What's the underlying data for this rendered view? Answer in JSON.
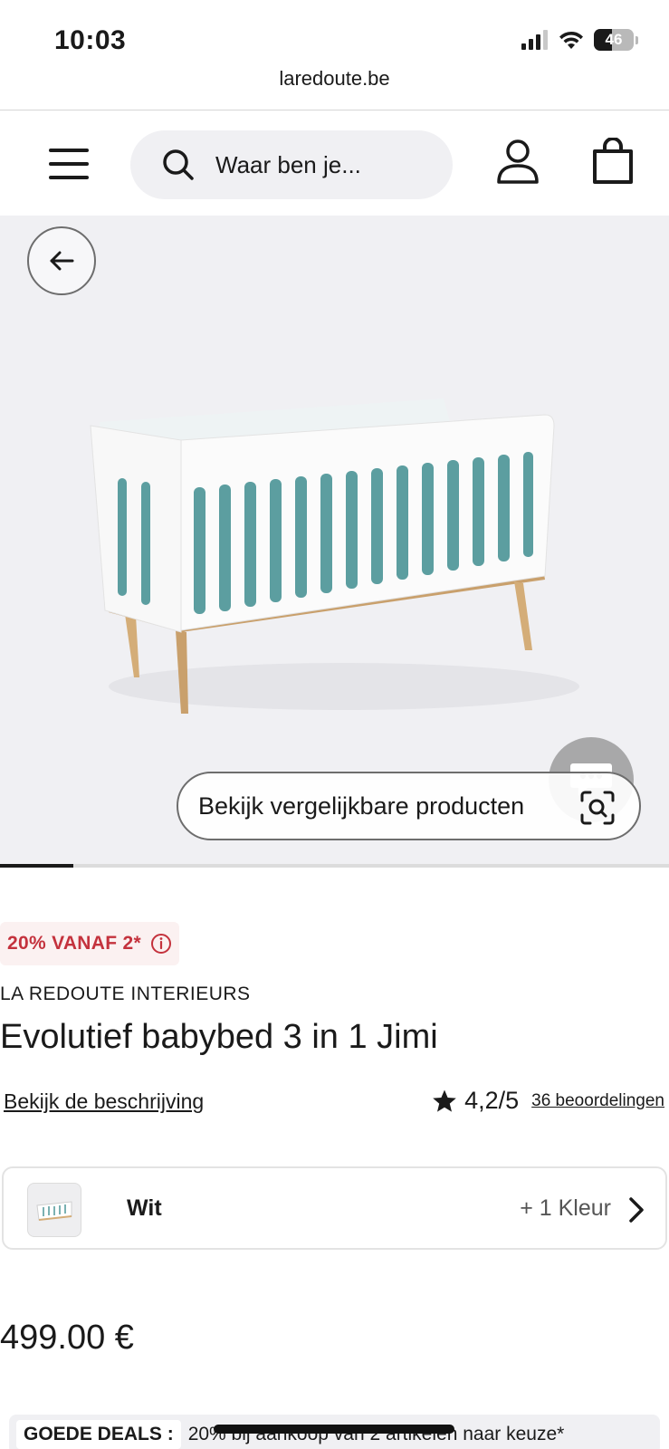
{
  "status_bar": {
    "time": "10:03",
    "battery": "46",
    "battery_level": 0.46
  },
  "browser": {
    "url": "laredoute.be"
  },
  "header": {
    "search_placeholder": "Waar ben je..."
  },
  "gallery": {
    "similar_button_label": "Bekijk vergelijkbare producten",
    "progress": 0.11
  },
  "product": {
    "promo": "20% VANAF 2*",
    "brand": "LA REDOUTE INTERIEURS",
    "title": "Evolutief babybed 3 in 1 Jimi",
    "description_link": "Bekijk de beschrijving",
    "rating": "4,2/5",
    "reviews_link": "36 beoordelingen",
    "color": {
      "selected": "Wit",
      "more": "+ 1 Kleur"
    },
    "price": "499.00 €"
  },
  "deals": {
    "tag": "GOEDE DEALS :",
    "text": "20% bij aankoop van 2 artikelen naar keuze*"
  },
  "colors": {
    "promo_red": "#c4323d",
    "background_grey": "#f0f0f3",
    "text": "#1a1a1a"
  }
}
